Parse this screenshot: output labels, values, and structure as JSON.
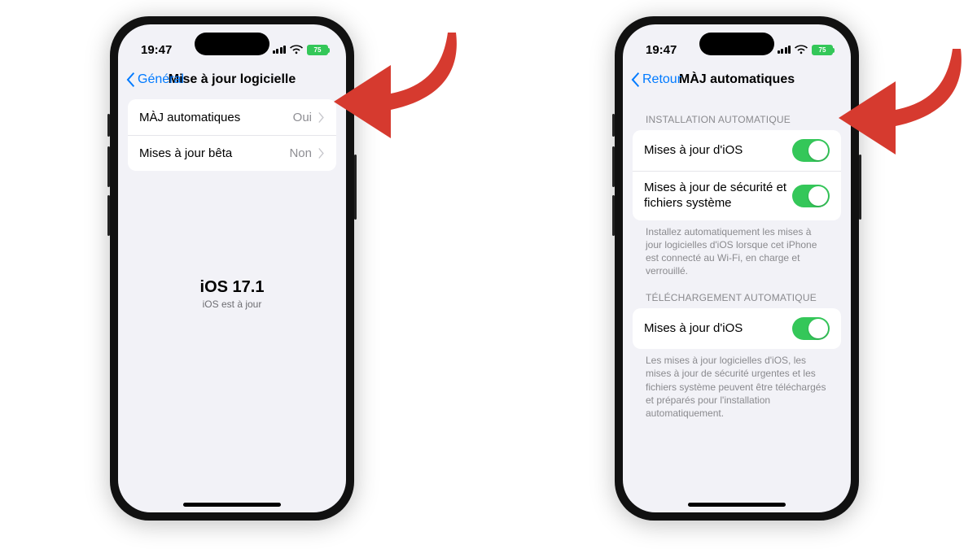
{
  "status": {
    "time": "19:47",
    "battery": "75"
  },
  "screen1": {
    "back": "Général",
    "title": "Mise à jour logicielle",
    "rows": [
      {
        "label": "MÀJ automatiques",
        "value": "Oui"
      },
      {
        "label": "Mises à jour bêta",
        "value": "Non"
      }
    ],
    "center": {
      "title": "iOS 17.1",
      "subtitle": "iOS est à jour"
    }
  },
  "screen2": {
    "back": "Retour",
    "title": "MÀJ automatiques",
    "section1": {
      "header": "INSTALLATION AUTOMATIQUE",
      "rows": [
        {
          "label": "Mises à jour d'iOS",
          "on": true
        },
        {
          "label": "Mises à jour de sécurité et fichiers système",
          "on": true
        }
      ],
      "footer": "Installez automatiquement les mises à jour logicielles d'iOS lorsque cet iPhone est connecté au Wi-Fi, en charge et verrouillé."
    },
    "section2": {
      "header": "TÉLÉCHARGEMENT AUTOMATIQUE",
      "rows": [
        {
          "label": "Mises à jour d'iOS",
          "on": true
        }
      ],
      "footer": "Les mises à jour logicielles d'iOS, les mises à jour de sécurité urgentes et les fichiers système peuvent être téléchargés et préparés pour l'installation automatiquement."
    }
  },
  "colors": {
    "accent_blue": "#007aff",
    "toggle_green": "#34c759",
    "arrow_red": "#d63a2f"
  }
}
